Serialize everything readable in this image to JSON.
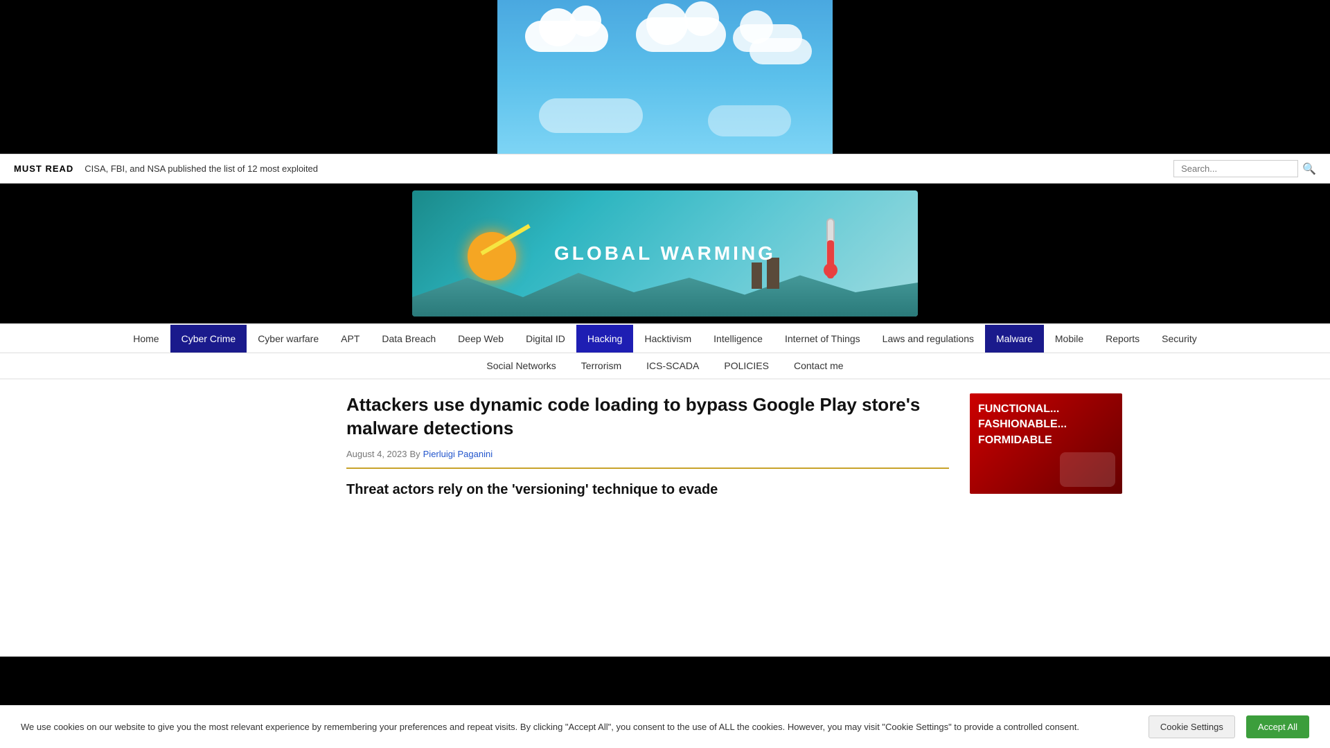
{
  "header": {
    "mustread_label": "MUST READ",
    "mustread_text": "CISA, FBI, and NSA published the list of 12 most exploited",
    "search_placeholder": "Search...",
    "banner_title": "GLOBAL WARMING"
  },
  "nav": {
    "primary": [
      {
        "label": "Home",
        "active": false
      },
      {
        "label": "Cyber Crime",
        "active": true
      },
      {
        "label": "Cyber warfare",
        "active": false
      },
      {
        "label": "APT",
        "active": false
      },
      {
        "label": "Data Breach",
        "active": false
      },
      {
        "label": "Deep Web",
        "active": false
      },
      {
        "label": "Digital ID",
        "active": false
      },
      {
        "label": "Hacking",
        "active": false,
        "highlight": true
      },
      {
        "label": "Hacktivism",
        "active": false
      },
      {
        "label": "Intelligence",
        "active": false
      },
      {
        "label": "Internet of Things",
        "active": false
      },
      {
        "label": "Laws and regulations",
        "active": false
      },
      {
        "label": "Malware",
        "active": false,
        "malware": true
      },
      {
        "label": "Mobile",
        "active": false
      },
      {
        "label": "Reports",
        "active": false
      },
      {
        "label": "Security",
        "active": false
      }
    ],
    "secondary": [
      {
        "label": "Social Networks"
      },
      {
        "label": "Terrorism"
      },
      {
        "label": "ICS-SCADA"
      },
      {
        "label": "POLICIES"
      },
      {
        "label": "Contact me"
      }
    ]
  },
  "article": {
    "title": "Attackers use dynamic code loading to bypass Google Play store's malware detections",
    "date": "August 4, 2023",
    "author_prefix": "By",
    "author": "Pierluigi Paganini",
    "subtitle": "Threat actors rely on the 'versioning' technique to evade"
  },
  "sidebar": {
    "ad_line1": "FUNCTIONAL...",
    "ad_line2": "FASHIONABLE...",
    "ad_line3": "FORMIDABLE"
  },
  "cookie": {
    "text": "We use cookies on our website to give you the most relevant experience by remembering your preferences and repeat visits. By clicking \"Accept All\", you consent to the use of ALL the cookies. However, you may visit \"Cookie Settings\" to provide a controlled consent.",
    "settings_label": "Cookie Settings",
    "accept_label": "Accept All"
  }
}
